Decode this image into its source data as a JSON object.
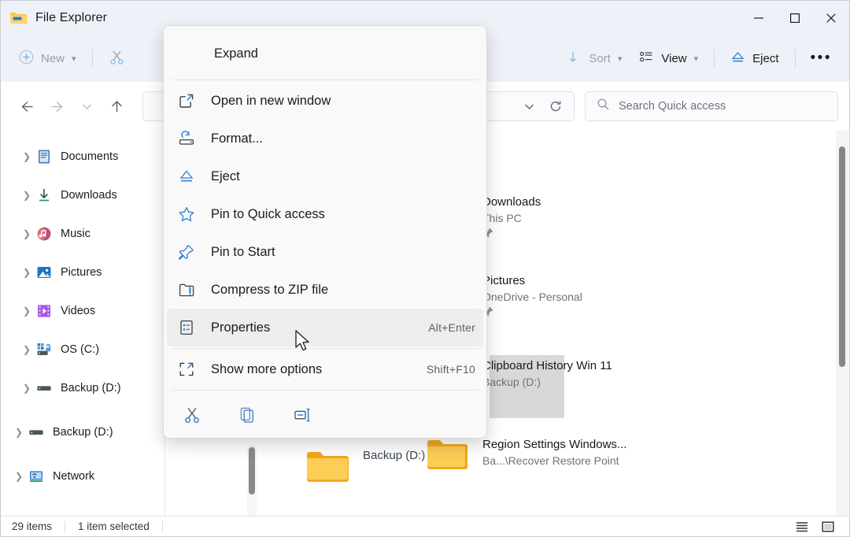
{
  "window": {
    "title": "File Explorer",
    "icon": "folder-icon",
    "controls": {
      "minimize": "–",
      "maximize": "☐",
      "close": "✕"
    }
  },
  "toolbar": {
    "new_label": "New",
    "cut_icon": "scissors-icon",
    "sort_label": "Sort",
    "view_label": "View",
    "eject_label": "Eject",
    "more_label": "•••"
  },
  "nav": {
    "back": "back-arrow",
    "forward": "forward-arrow",
    "recent": "chevron-down",
    "up": "up-arrow"
  },
  "search": {
    "placeholder": "Search Quick access"
  },
  "sidebar": {
    "items": [
      {
        "label": "Documents",
        "icon": "documents-icon",
        "level": 1
      },
      {
        "label": "Downloads",
        "icon": "downloads-icon",
        "level": 1
      },
      {
        "label": "Music",
        "icon": "music-icon",
        "level": 1
      },
      {
        "label": "Pictures",
        "icon": "pictures-icon",
        "level": 1
      },
      {
        "label": "Videos",
        "icon": "videos-icon",
        "level": 1
      },
      {
        "label": "OS (C:)",
        "icon": "os-drive-icon",
        "level": 1
      },
      {
        "label": "Backup (D:)",
        "icon": "drive-icon",
        "level": 1
      },
      {
        "label": "Backup (D:)",
        "icon": "drive-icon",
        "level": 0
      },
      {
        "label": "Network",
        "icon": "network-icon",
        "level": 0
      }
    ]
  },
  "content": {
    "items": [
      {
        "name": "Downloads",
        "subtitle": "This PC",
        "icon": "green-folder-icon",
        "pinned": true,
        "cloud": false
      },
      {
        "name": "Pictures",
        "subtitle": "OneDrive - Personal",
        "icon": "blue-picture-folder-icon",
        "pinned": true,
        "cloud": true
      },
      {
        "name": "Clipboard History Win 11",
        "subtitle": "Backup (D:)",
        "icon": "yellow-folder-icon",
        "pinned": false,
        "cloud": false
      },
      {
        "name": "Region Settings Windows...",
        "subtitle": "Ba...\\Recover Restore Point",
        "icon": "yellow-folder-icon",
        "pinned": false,
        "cloud": false
      }
    ],
    "partial_item": {
      "name": "Backup (D:)",
      "icon": "yellow-folder-icon"
    }
  },
  "context_menu": {
    "header": "Expand",
    "items": [
      {
        "label": "Open in new window",
        "icon": "open-new-window-icon",
        "accelerator": "",
        "highlight": false
      },
      {
        "label": "Format...",
        "icon": "format-icon",
        "accelerator": "",
        "highlight": false
      },
      {
        "label": "Eject",
        "icon": "eject-icon",
        "accelerator": "",
        "highlight": false
      },
      {
        "label": "Pin to Quick access",
        "icon": "star-icon",
        "accelerator": "",
        "highlight": false
      },
      {
        "label": "Pin to Start",
        "icon": "pin-icon",
        "accelerator": "",
        "highlight": false
      },
      {
        "label": "Compress to ZIP file",
        "icon": "zip-icon",
        "accelerator": "",
        "highlight": false
      },
      {
        "label": "Properties",
        "icon": "properties-icon",
        "accelerator": "Alt+Enter",
        "highlight": true
      }
    ],
    "more_item": {
      "label": "Show more options",
      "icon": "show-more-icon",
      "accelerator": "Shift+F10"
    },
    "icon_row": [
      {
        "icon": "cut-icon"
      },
      {
        "icon": "copy-icon"
      },
      {
        "icon": "rename-icon"
      }
    ]
  },
  "statusbar": {
    "items_count": "29 items",
    "selection": "1 item selected",
    "view_list_icon": "list-view-icon",
    "view_details_icon": "details-view-icon"
  },
  "colors": {
    "accent": "#0f6cbd",
    "toolbar_bg": "#eef1f8",
    "menu_bg": "#f9f9f9",
    "selection": "#d8d8d8"
  }
}
